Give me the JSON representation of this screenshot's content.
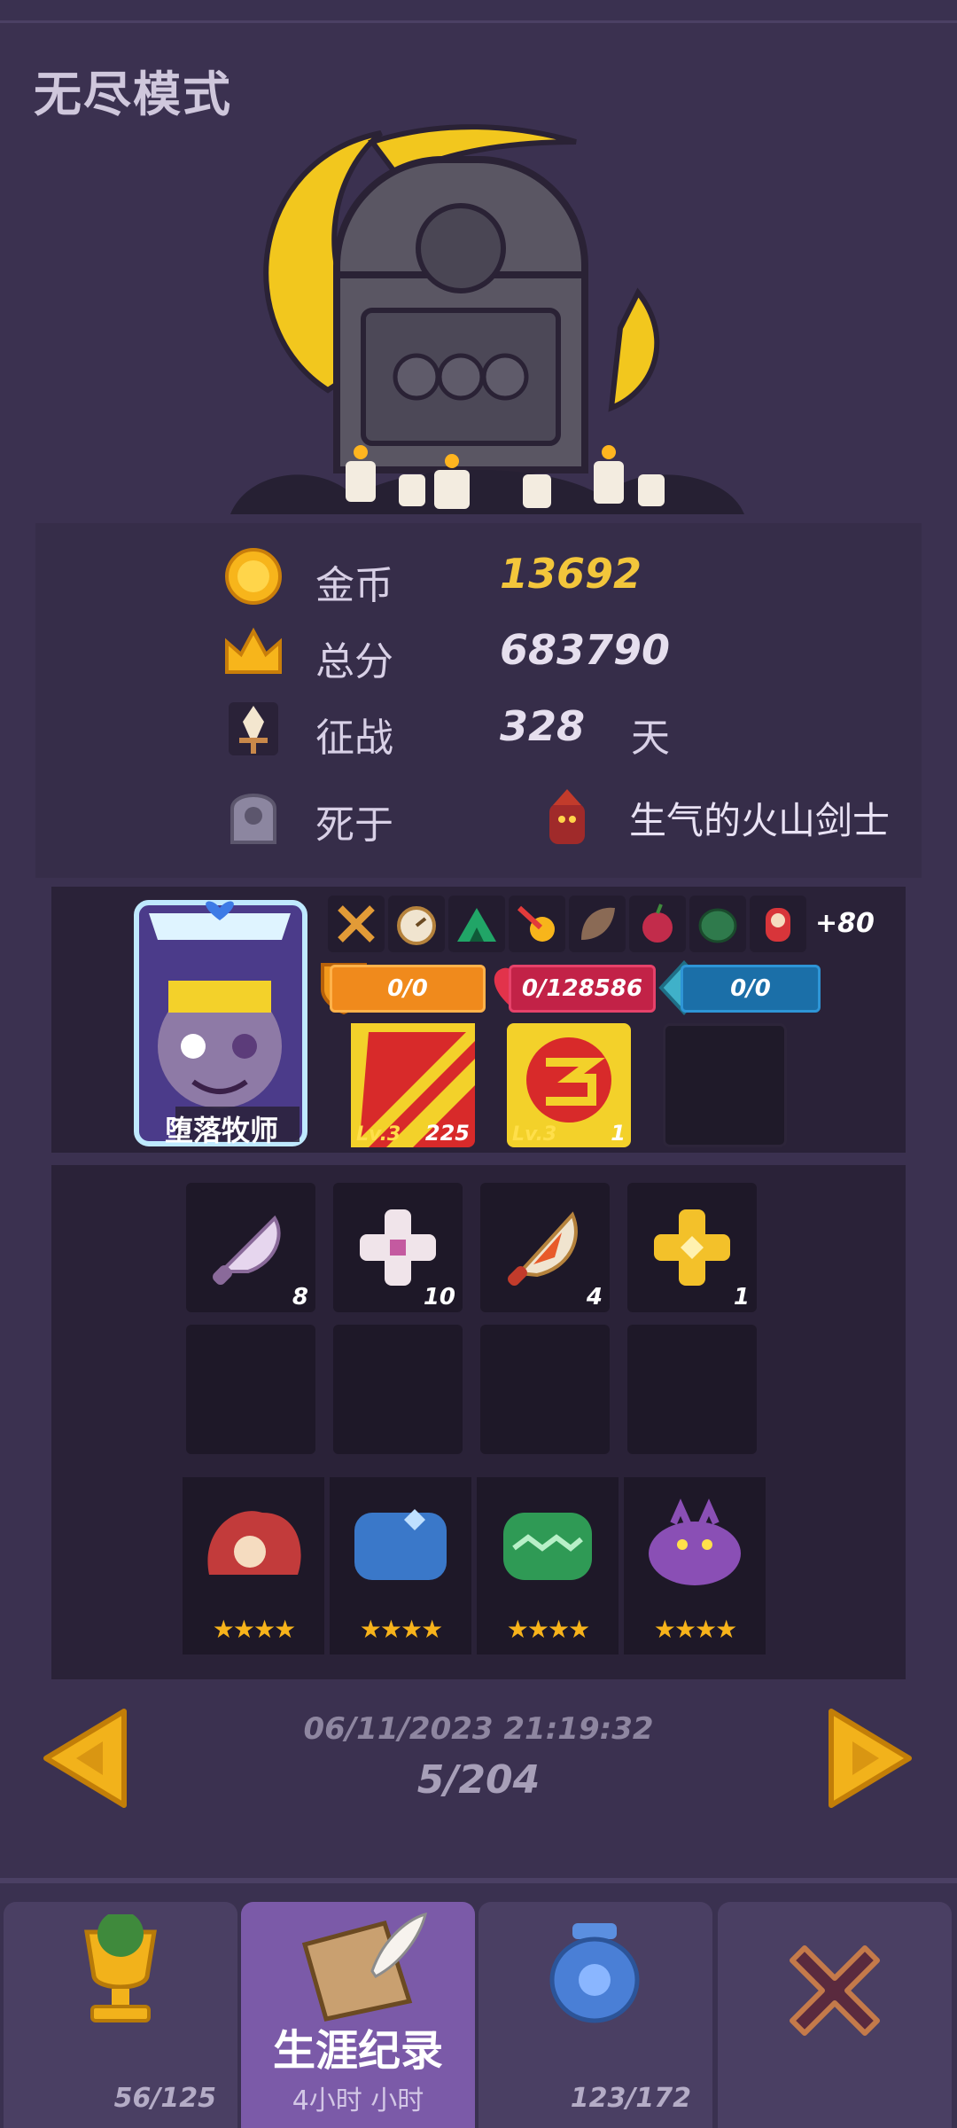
{
  "title": "无尽模式",
  "stats": {
    "gold_label": "金币",
    "gold_value": "13692",
    "score_label": "总分",
    "score_value": "683790",
    "campaign_label": "征战",
    "campaign_value": "328",
    "campaign_unit": "天",
    "death_label": "死于",
    "killer_name": "生气的火山剑士"
  },
  "hero": {
    "name": "堕落牧师",
    "relics": [
      "crossed-swords-icon",
      "stopwatch-icon",
      "tent-icon",
      "fire-arrow-icon",
      "spiky-leaf-icon",
      "apple-icon",
      "turtle-shell-icon",
      "doll-icon"
    ],
    "relic_more": "+80",
    "shield": "0/0",
    "hp": "0/128586",
    "mana": "0/0",
    "skills": [
      {
        "level": "Lv.3",
        "count": "225"
      },
      {
        "level": "Lv.3",
        "count": "1"
      }
    ]
  },
  "items": [
    {
      "icon": "knife-icon",
      "count": "8"
    },
    {
      "icon": "bandage-icon",
      "count": "10"
    },
    {
      "icon": "fire-dagger-icon",
      "count": "4"
    },
    {
      "icon": "gold-cross-icon",
      "count": "1"
    }
  ],
  "allies": [
    {
      "icon": "red-hedgehog-icon",
      "stars": "★★★★"
    },
    {
      "icon": "blue-golem-icon",
      "stars": "★★★★"
    },
    {
      "icon": "green-slime-icon",
      "stars": "★★★★"
    },
    {
      "icon": "purple-ogre-icon",
      "stars": "★★★★"
    }
  ],
  "record": {
    "date": "06/11/2023 21:19:32",
    "page": "5/204"
  },
  "tabs": [
    {
      "icon": "trophy-icon",
      "count": "56/125"
    },
    {
      "icon": "scroll-quill-icon",
      "label": "生涯纪录",
      "sub": "4小时  小时"
    },
    {
      "icon": "blue-jar-icon",
      "count": "123/172"
    },
    {
      "icon": "close-icon"
    }
  ]
}
